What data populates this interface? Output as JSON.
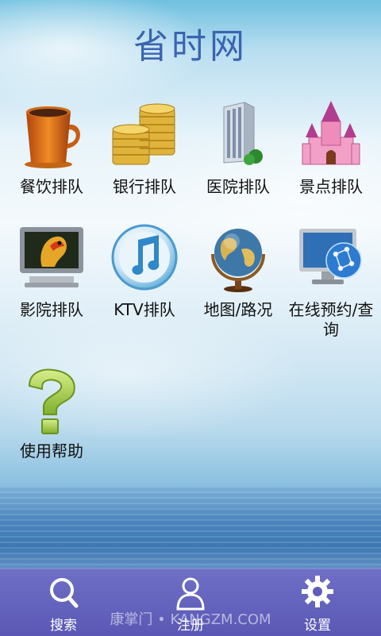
{
  "app_title": "省时网",
  "grid": {
    "items": [
      {
        "label": "餐饮排队",
        "icon": "coffee-cup-icon"
      },
      {
        "label": "银行排队",
        "icon": "coins-icon"
      },
      {
        "label": "医院排队",
        "icon": "hospital-building-icon"
      },
      {
        "label": "景点排队",
        "icon": "castle-icon"
      },
      {
        "label": "影院排队",
        "icon": "tv-parrot-icon"
      },
      {
        "label": "KTV排队",
        "icon": "music-note-icon"
      },
      {
        "label": "地图/路况",
        "icon": "globe-icon"
      },
      {
        "label_line1": "在线预约/查",
        "label_line2": "询",
        "icon": "monitor-globe-icon"
      },
      {
        "label": "使用帮助",
        "icon": "question-mark-icon"
      }
    ]
  },
  "bottom_bar": {
    "tabs": [
      {
        "label": "搜索",
        "icon": "search-icon"
      },
      {
        "label": "注册",
        "icon": "user-icon"
      },
      {
        "label": "设置",
        "icon": "gear-icon"
      }
    ]
  },
  "watermark": "康掌门 • KANGZM.COM"
}
